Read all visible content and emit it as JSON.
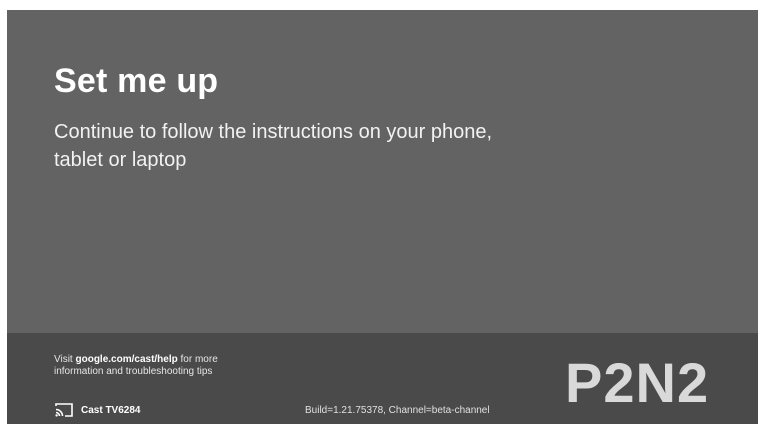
{
  "setup": {
    "title": "Set me up",
    "instructions": "Continue to follow the instructions on your phone, tablet or laptop"
  },
  "footer": {
    "help_prefix": "Visit ",
    "help_link": "google.com/cast/help",
    "help_suffix": " for more information and troubleshooting tips",
    "device_name": "Cast TV6284",
    "device_icon": "cast-icon",
    "build_info": "Build=1.21.75378, Channel=beta-channel",
    "setup_code": "P2N2"
  },
  "colors": {
    "main_background": "#636363",
    "footer_background": "#4a4a4a",
    "text": "#ffffff",
    "code_text": "#d9d9d9"
  }
}
